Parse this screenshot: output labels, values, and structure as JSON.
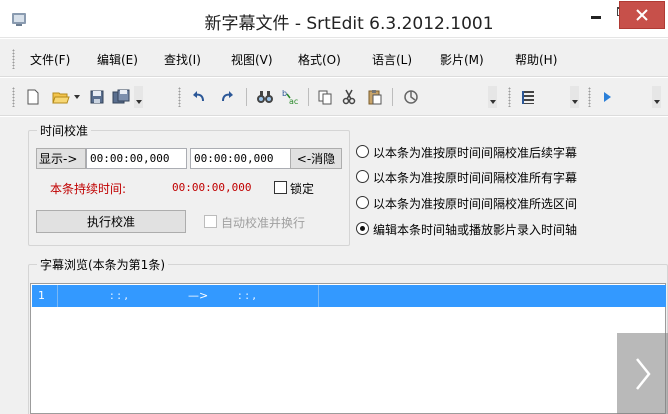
{
  "window": {
    "title": "新字幕文件 - SrtEdit 6.3.2012.1001",
    "icons": {
      "app": "app-icon",
      "minimize": "minimize-icon",
      "maximize": "maximize-icon",
      "close": "close-icon"
    },
    "colors": {
      "close": "#c7504a",
      "selection": "#3399ff"
    }
  },
  "menu": {
    "items": [
      "文件(F)",
      "编辑(E)",
      "查找(I)",
      "视图(V)",
      "格式(O)",
      "语言(L)",
      "影片(M)",
      "帮助(H)"
    ]
  },
  "toolbar": {
    "icons": [
      "new-file-icon",
      "open-folder-icon",
      "save-icon",
      "save-as-icon",
      "undo-icon",
      "redo-icon",
      "find-icon",
      "replace-icon",
      "copy-icon",
      "cut-icon",
      "paste-icon",
      "clear-icon",
      "list-view-icon",
      "play-icon"
    ]
  },
  "calibration": {
    "legend": "时间校准",
    "show_button": "显示->",
    "start_time": "00:00:00,000",
    "end_time": "00:00:00,000",
    "cancel_label": "<-消隐",
    "duration_label": "本条持续时间:",
    "duration_value": "00:00:00,000",
    "lock_label": "锁定",
    "execute_button": "执行校准",
    "auto_label": "自动校准并换行"
  },
  "options": {
    "items": [
      {
        "label": "以本条为准按原时间间隔校准后续字幕",
        "selected": false
      },
      {
        "label": "以本条为准按原时间间隔校准所有字幕",
        "selected": false
      },
      {
        "label": "以本条为准按原时间间隔校准所选区间",
        "selected": false
      },
      {
        "label": "编辑本条时间轴或播放影片录入时间轴",
        "selected": true
      }
    ]
  },
  "browse": {
    "legend": "字幕浏览(本条为第1条)",
    "row": {
      "index": "1",
      "start_text": ":  :  ,",
      "arrow": "—>",
      "end_text": ":  :  ,"
    }
  },
  "nav": {
    "next": ">"
  }
}
